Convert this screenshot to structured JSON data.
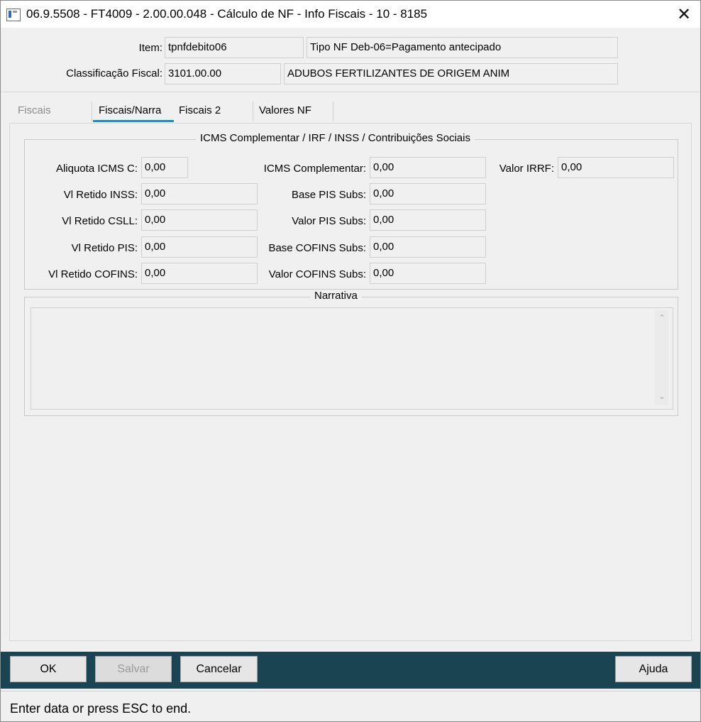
{
  "window": {
    "title": "06.9.5508 - FT4009 - 2.00.00.048 - Cálculo de NF - Info Fiscais - 10 - 8185",
    "close_glyph": "✕"
  },
  "header": {
    "item_label": "Item:",
    "item_value": "tpnfdebito06",
    "item_desc": "Tipo NF Deb-06=Pagamento antecipado",
    "class_label": "Classificação Fiscal:",
    "class_value": "3101.00.00",
    "class_desc": "ADUBOS FERTILIZANTES DE ORIGEM ANIM"
  },
  "tabs": [
    {
      "label": "Fiscais",
      "state": "disabled"
    },
    {
      "label": "Fiscais/Narra",
      "state": "active"
    },
    {
      "label": "Fiscais 2",
      "state": "normal"
    },
    {
      "label": "Valores NF",
      "state": "normal"
    }
  ],
  "icms_group": {
    "title": "ICMS Complementar / IRF / INSS / Contribuições Sociais",
    "col1": [
      {
        "label": "Aliquota ICMS C:",
        "value": "0,00"
      },
      {
        "label": "Vl Retido INSS:",
        "value": "0,00"
      },
      {
        "label": "Vl Retido CSLL:",
        "value": "0,00"
      },
      {
        "label": "Vl Retido PIS:",
        "value": "0,00"
      },
      {
        "label": "Vl Retido COFINS:",
        "value": "0,00"
      }
    ],
    "col2": [
      {
        "label": "ICMS Complementar:",
        "value": "0,00"
      },
      {
        "label": "Base PIS Subs:",
        "value": "0,00"
      },
      {
        "label": "Valor PIS Subs:",
        "value": "0,00"
      },
      {
        "label": "Base COFINS Subs:",
        "value": "0,00"
      },
      {
        "label": "Valor COFINS Subs:",
        "value": "0,00"
      }
    ],
    "col3": [
      {
        "label": "Valor IRRF:",
        "value": "0,00"
      }
    ]
  },
  "narrativa": {
    "title": "Narrativa",
    "text": "",
    "scroll_up": "⌃",
    "scroll_down": "⌄"
  },
  "buttons": {
    "ok": "OK",
    "salvar": "Salvar",
    "cancelar": "Cancelar",
    "ajuda": "Ajuda"
  },
  "status": {
    "text": "Enter data or press ESC to end."
  }
}
